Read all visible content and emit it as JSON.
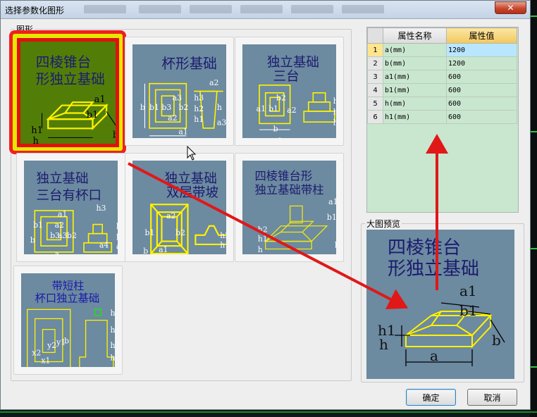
{
  "window": {
    "title": "选择参数化图形",
    "close_glyph": "✕"
  },
  "shapes_group": {
    "label": "图形"
  },
  "shapes": [
    {
      "id": "tile-1",
      "lines": [
        "四棱锥台",
        "形独立基础"
      ],
      "dims": [
        "a1",
        "b1",
        "h1",
        "h",
        "a",
        "b"
      ],
      "selected": true
    },
    {
      "id": "tile-2",
      "lines": [
        "杯形基础"
      ],
      "dims": [
        "a2",
        "a3",
        "b3",
        "b2",
        "a2",
        "h3",
        "h2",
        "h1",
        "b",
        "b1",
        "a1",
        "a",
        "a3",
        "h"
      ],
      "selected": false
    },
    {
      "id": "tile-3",
      "lines": [
        "独立基础",
        "三台"
      ],
      "dims": [
        "b2",
        "a2",
        "a1",
        "b1",
        "a",
        "b",
        "h3",
        "h2",
        "h1"
      ],
      "selected": false
    },
    {
      "id": "tile-4",
      "lines": [
        "独立基础",
        "三台有杯口"
      ],
      "dims": [
        "a1",
        "a2",
        "b1",
        "a3",
        "b3",
        "b2",
        "b",
        "a",
        "h3",
        "h2",
        "h1",
        "a3",
        "a4"
      ],
      "selected": false
    },
    {
      "id": "tile-5",
      "lines": [
        "独立基础",
        "双层带坡"
      ],
      "dims": [
        "a2",
        "b1",
        "b2",
        "a1",
        "a",
        "b",
        "h2",
        "h1"
      ],
      "selected": false
    },
    {
      "id": "tile-6",
      "lines": [
        "四棱锥台形",
        "独立基础带柱"
      ],
      "dims": [
        "a1",
        "b1",
        "h2",
        "h1",
        "h",
        "a",
        "b"
      ],
      "selected": false
    },
    {
      "id": "tile-7",
      "lines": [
        "带短柱",
        "杯口独立基础"
      ],
      "dims": [
        "x2",
        "x1",
        "y2",
        "y1",
        "b",
        "a",
        "h4",
        "h3",
        "h1",
        "h2"
      ],
      "selected": false
    }
  ],
  "properties": {
    "headers": {
      "name": "属性名称",
      "value": "属性值"
    },
    "rows": [
      {
        "num": "1",
        "name": "a(mm)",
        "value": "1200"
      },
      {
        "num": "2",
        "name": "b(mm)",
        "value": "1200"
      },
      {
        "num": "3",
        "name": "a1(mm)",
        "value": "600"
      },
      {
        "num": "4",
        "name": "b1(mm)",
        "value": "600"
      },
      {
        "num": "5",
        "name": "h(mm)",
        "value": "600"
      },
      {
        "num": "6",
        "name": "h1(mm)",
        "value": "600"
      }
    ]
  },
  "preview": {
    "label": "大图预览",
    "lines": [
      "四棱锥台",
      "形独立基础"
    ],
    "dims": [
      "a1",
      "b1",
      "h1",
      "h",
      "a",
      "b"
    ]
  },
  "buttons": {
    "ok": "确定",
    "cancel": "取消"
  },
  "colors": {
    "accent_red": "#e01818",
    "sketch_yellow": "#fff200",
    "tile_blue": "#6c8aa0",
    "selected_green": "#527e08"
  }
}
